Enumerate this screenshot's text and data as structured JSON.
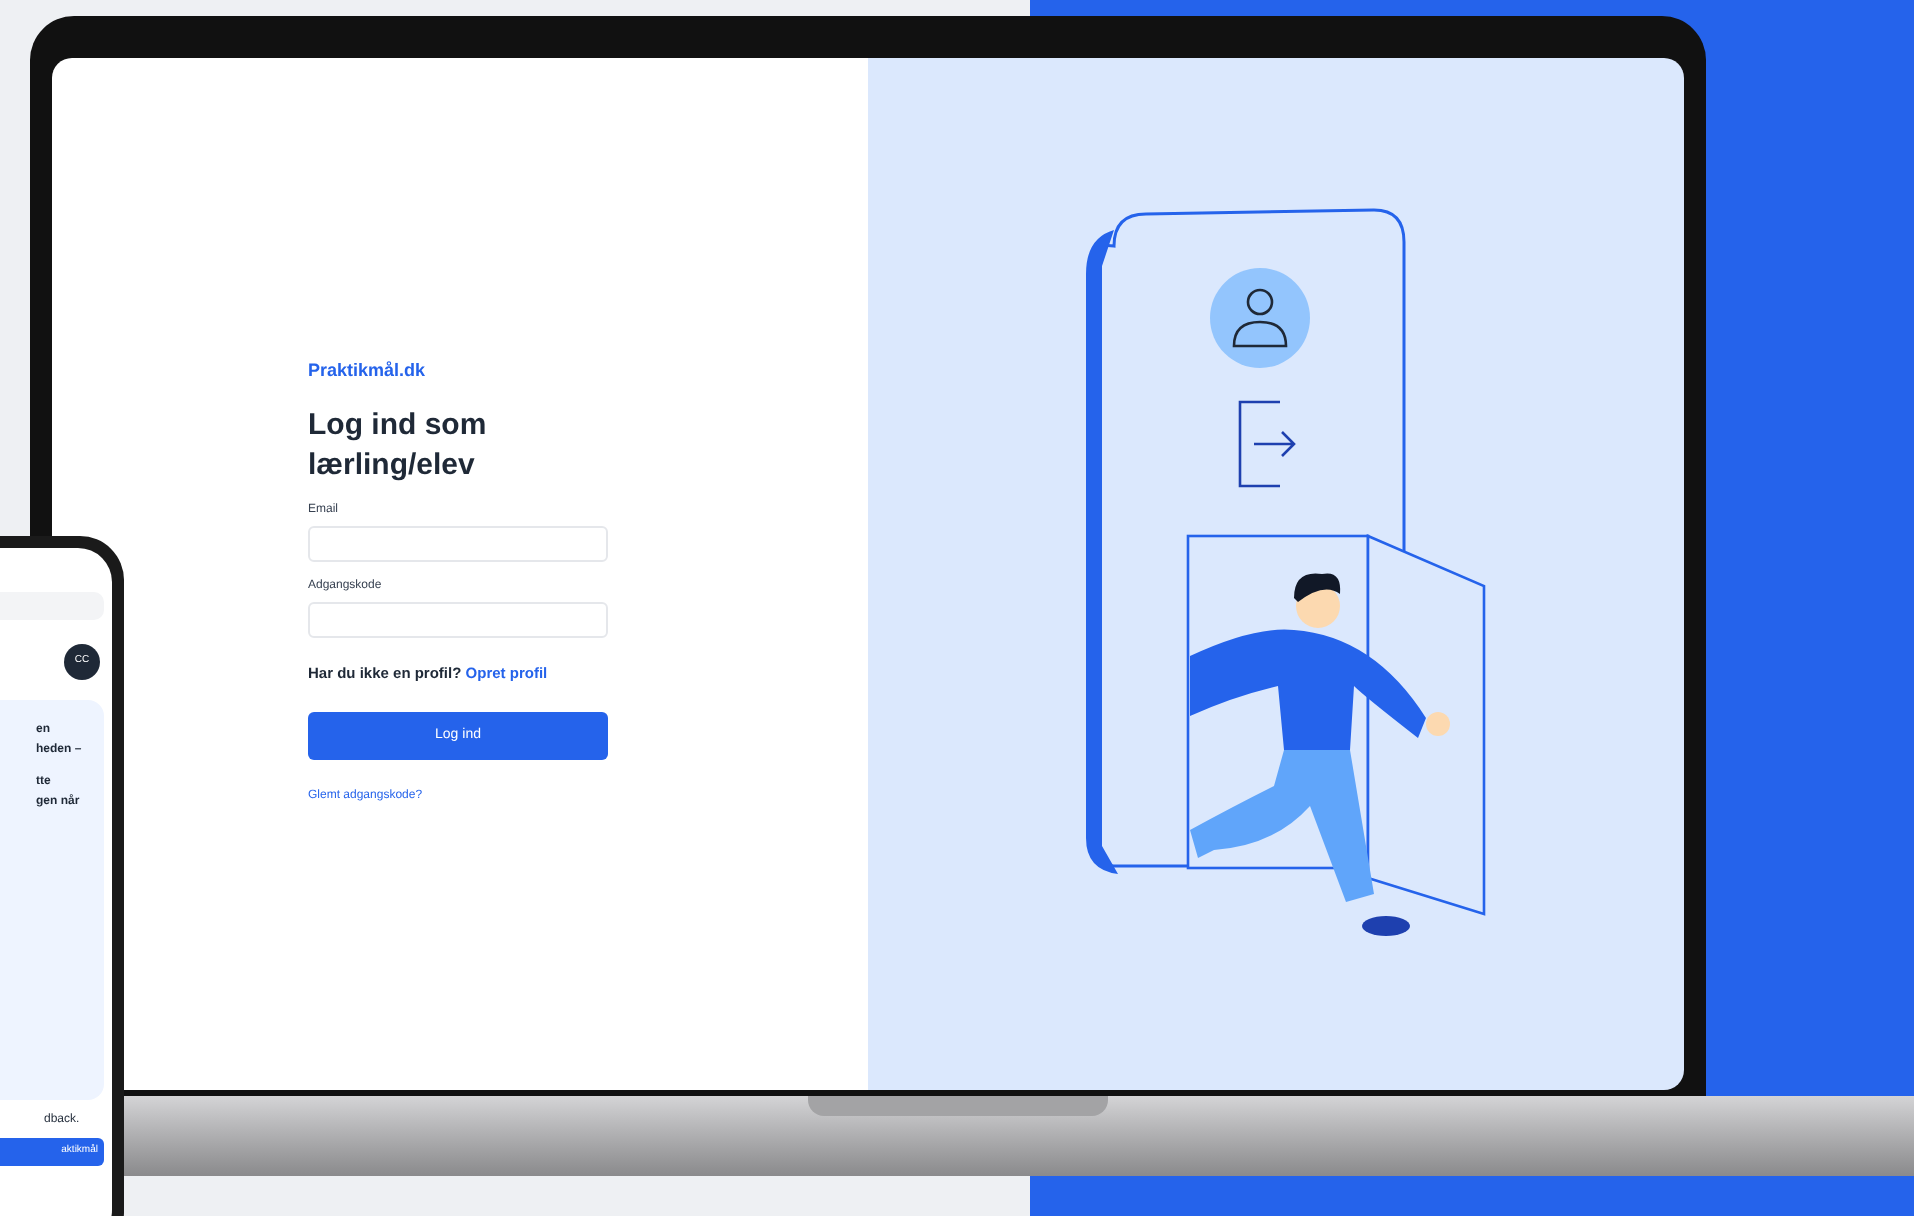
{
  "laptop_screen": {
    "brand": "Praktikmål.dk",
    "heading": "Log ind som lærling/elev",
    "fields": [
      {
        "label": "Email"
      },
      {
        "label": "Adgangskode"
      }
    ],
    "signup_prompt": "Har du ikke en profil?",
    "signup_link": "Opret profil",
    "submit_button": "Log ind",
    "forgot_link": "Glemt adgangskode?"
  },
  "phone_screen": {
    "avatar_initials": "CC",
    "card_paragraphs": [
      [
        "en",
        "heden –"
      ],
      [
        "tte",
        "gen når"
      ]
    ],
    "footer_text": "dback.",
    "footer_button": "aktikmål"
  }
}
